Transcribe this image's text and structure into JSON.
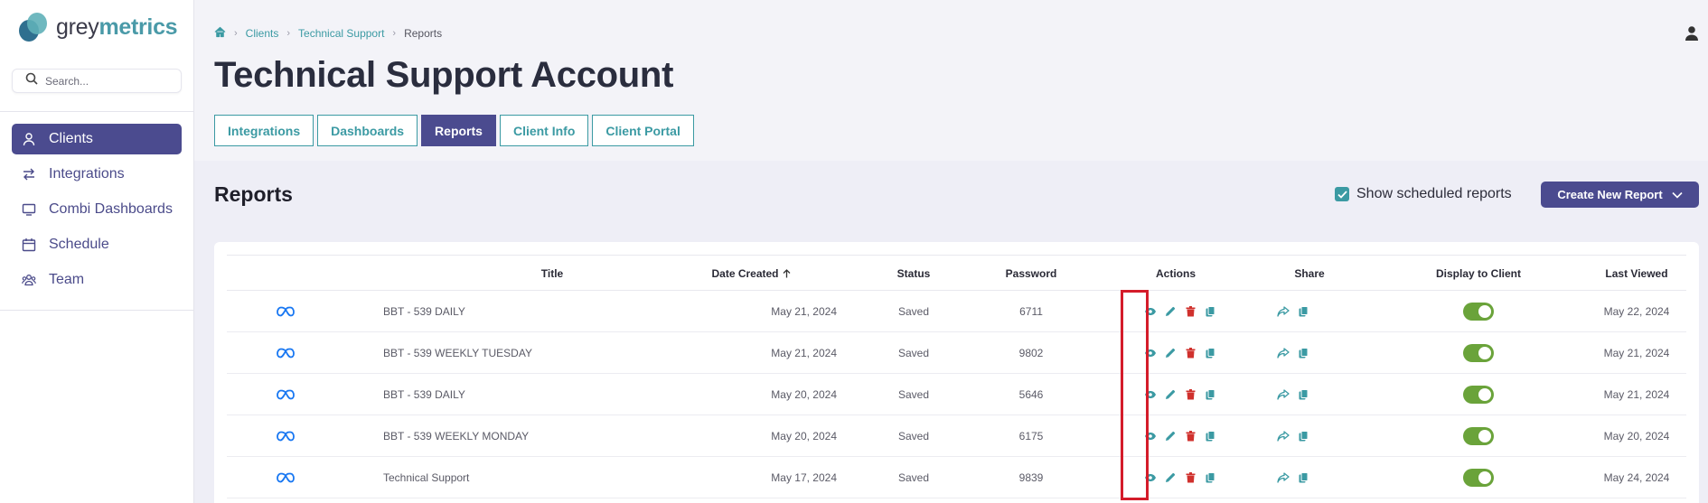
{
  "app": {
    "logo_grey": "grey",
    "logo_metrics": "metrics",
    "accent": "#4b4b8f",
    "teal": "#3b9aa3"
  },
  "search": {
    "placeholder": "Search..."
  },
  "sidebar": {
    "items": [
      {
        "label": "Clients",
        "icon": "user-icon",
        "active": true
      },
      {
        "label": "Integrations",
        "icon": "arrows-icon",
        "active": false
      },
      {
        "label": "Combi Dashboards",
        "icon": "monitor-icon",
        "active": false
      },
      {
        "label": "Schedule",
        "icon": "calendar-icon",
        "active": false
      },
      {
        "label": "Team",
        "icon": "team-icon",
        "active": false
      }
    ]
  },
  "breadcrumb": {
    "home_icon": "home-icon",
    "items": [
      "Clients",
      "Technical Support"
    ],
    "current": "Reports"
  },
  "page": {
    "title": "Technical Support Account"
  },
  "tabs": [
    {
      "label": "Integrations",
      "active": false
    },
    {
      "label": "Dashboards",
      "active": false
    },
    {
      "label": "Reports",
      "active": true
    },
    {
      "label": "Client Info",
      "active": false
    },
    {
      "label": "Client Portal",
      "active": false
    }
  ],
  "reports": {
    "title": "Reports",
    "show_scheduled_label": "Show scheduled reports",
    "show_scheduled_checked": true,
    "create_button": "Create New Report"
  },
  "table": {
    "columns": {
      "title": "Title",
      "date": "Date Created",
      "status": "Status",
      "password": "Password",
      "actions": "Actions",
      "share": "Share",
      "display": "Display to Client",
      "last_viewed": "Last Viewed"
    },
    "rows": [
      {
        "source_icon": "meta-icon",
        "title": "BBT - 539 DAILY",
        "date": "May 21, 2024",
        "status": "Saved",
        "password": "6711",
        "display": true,
        "last_viewed": "May 22, 2024"
      },
      {
        "source_icon": "meta-icon",
        "title": "BBT - 539 WEEKLY TUESDAY",
        "date": "May 21, 2024",
        "status": "Saved",
        "password": "9802",
        "display": true,
        "last_viewed": "May 21, 2024"
      },
      {
        "source_icon": "meta-icon",
        "title": "BBT - 539 DAILY",
        "date": "May 20, 2024",
        "status": "Saved",
        "password": "5646",
        "display": true,
        "last_viewed": "May 21, 2024"
      },
      {
        "source_icon": "meta-icon",
        "title": "BBT - 539 WEEKLY MONDAY",
        "date": "May 20, 2024",
        "status": "Saved",
        "password": "6175",
        "display": true,
        "last_viewed": "May 20, 2024"
      },
      {
        "source_icon": "meta-icon",
        "title": "Technical Support",
        "date": "May 17, 2024",
        "status": "Saved",
        "password": "9839",
        "display": true,
        "last_viewed": "May 24, 2024"
      }
    ]
  }
}
